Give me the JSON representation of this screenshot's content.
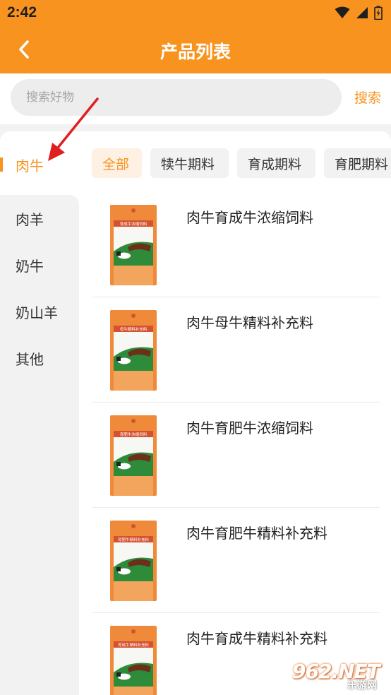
{
  "status_bar": {
    "time": "2:42"
  },
  "header": {
    "title": "产品列表"
  },
  "search": {
    "placeholder": "搜索好物",
    "button_label": "搜索"
  },
  "sidebar": {
    "items": [
      {
        "label": "肉牛",
        "active": true
      },
      {
        "label": "肉羊",
        "active": false
      },
      {
        "label": "奶牛",
        "active": false
      },
      {
        "label": "奶山羊",
        "active": false
      },
      {
        "label": "其他",
        "active": false
      }
    ]
  },
  "tabs": [
    {
      "label": "全部",
      "active": true
    },
    {
      "label": "犊牛期料",
      "active": false
    },
    {
      "label": "育成期料",
      "active": false
    },
    {
      "label": "育肥期料",
      "active": false
    }
  ],
  "products": [
    {
      "name": "肉牛育成牛浓缩饲料",
      "bag_label": "育成牛浓缩饲料"
    },
    {
      "name": "肉牛母牛精料补充料",
      "bag_label": "母牛精料补充料"
    },
    {
      "name": "肉牛育肥牛浓缩饲料",
      "bag_label": "育肥牛浓缩饲料"
    },
    {
      "name": "肉牛育肥牛精料补充料",
      "bag_label": "育肥牛精料补充料"
    },
    {
      "name": "肉牛育成牛精料补充料",
      "bag_label": "育成牛精料补充料"
    }
  ],
  "watermark": {
    "text": "962.NET",
    "sub": "乐游网"
  },
  "colors": {
    "accent": "#F7931E",
    "annotation": "#E02020",
    "background": "#F2F2F2"
  }
}
